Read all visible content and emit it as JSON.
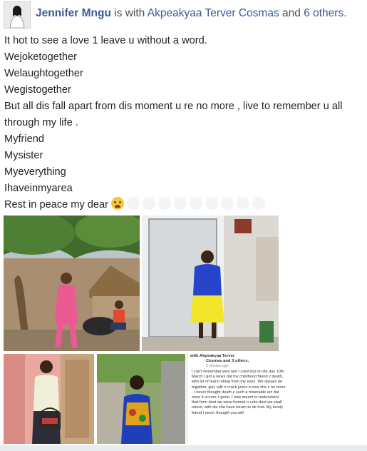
{
  "header": {
    "author": "Jennifer Mngu",
    "is_with": "is with",
    "tagged": "Akpeakyaa Terver Cosmas",
    "and": "and",
    "others": "6 others."
  },
  "post": {
    "lines": [
      "It hot to see a love 1 leave u without a word.",
      "Wejoketogether",
      "Welaughtogether",
      "Wegistogether",
      "But all dis fall apart from dis moment u re no more , live to remember u all through my life .",
      "Myfriend",
      "Mysister",
      "Myeverything",
      "Ihaveinmyarea"
    ],
    "last_line": "Rest in peace my dear",
    "emoji": "crying-face"
  },
  "screenshot_text": {
    "header": "with Akpeakyaa Terver",
    "header2": "Cosmas and 3 others.",
    "meta": "5 minutes ago",
    "body": "I can't remember wen last I cried but on dis day 10th March I got a news dat my childhood friend z death, with lot of tears rolling from my eyes. We always be together, gist, talk n crack jokes n now she z no more . I never thought death z such a miserable act dat once it occurs z gone. I was meant to understand that from dust we were formed n unto dust we shall return, with dis she have return to de lord. My lovely friend I never thought you will"
  },
  "colors": {
    "link": "#3b5998",
    "text": "#1d2129"
  }
}
